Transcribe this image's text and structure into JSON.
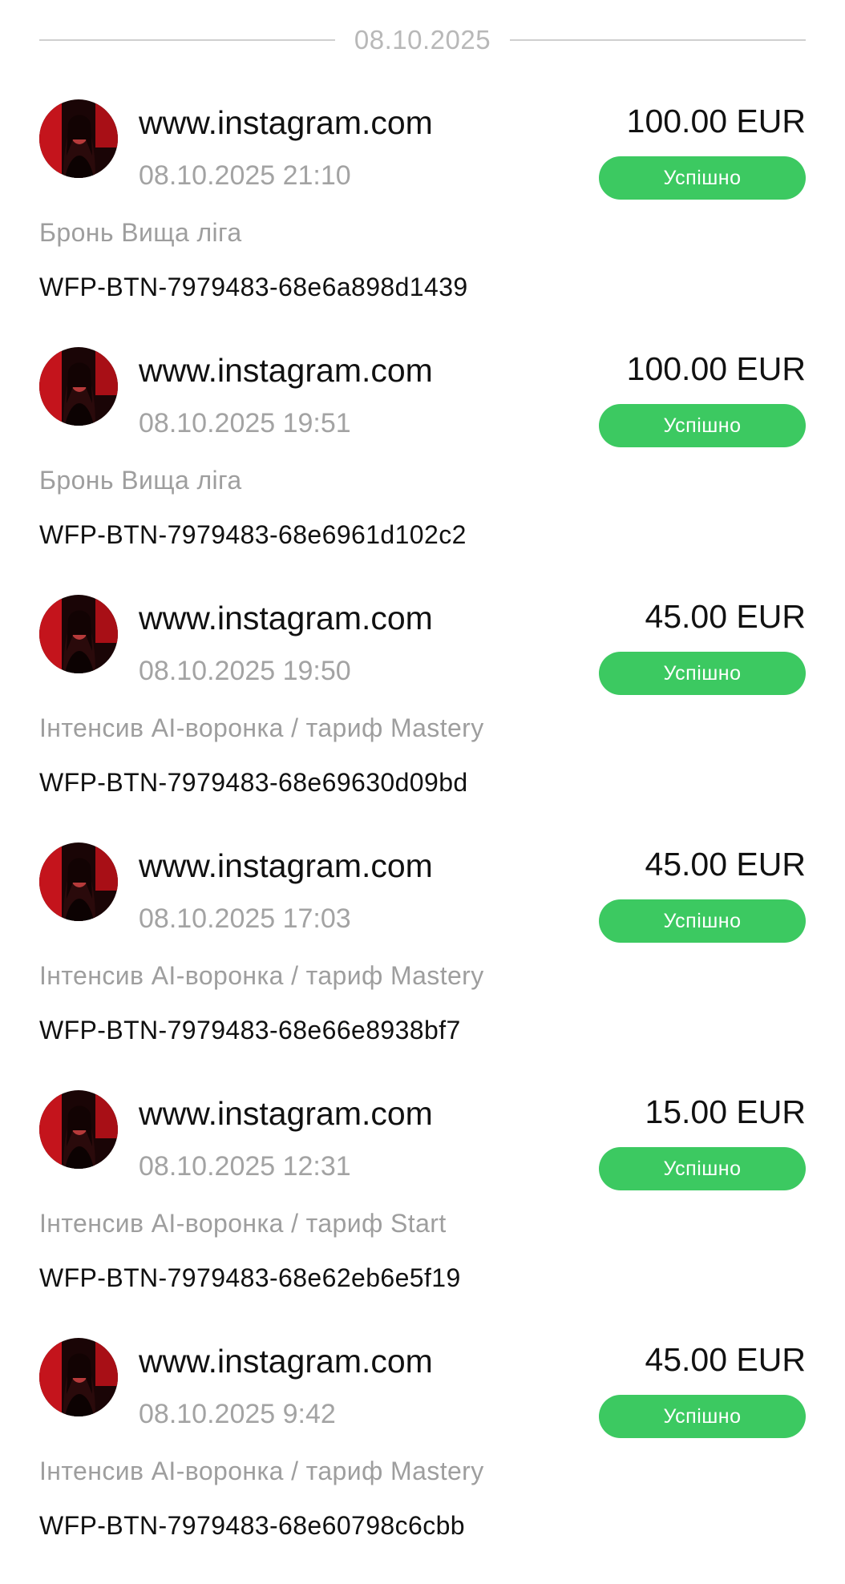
{
  "date_divider": "08.10.2025",
  "status_color": "#3cc961",
  "avatar_icon": "profile-photo",
  "transactions": [
    {
      "merchant": "www.instagram.com",
      "datetime": "08.10.2025 21:10",
      "amount": "100.00 EUR",
      "status": "Успішно",
      "description": "Бронь Вища ліга",
      "order_id": "WFP-BTN-7979483-68e6a898d1439"
    },
    {
      "merchant": "www.instagram.com",
      "datetime": "08.10.2025 19:51",
      "amount": "100.00 EUR",
      "status": "Успішно",
      "description": "Бронь Вища ліга",
      "order_id": "WFP-BTN-7979483-68e6961d102c2"
    },
    {
      "merchant": "www.instagram.com",
      "datetime": "08.10.2025 19:50",
      "amount": "45.00 EUR",
      "status": "Успішно",
      "description": "Інтенсив AI-воронка / тариф Mastery",
      "order_id": "WFP-BTN-7979483-68e69630d09bd"
    },
    {
      "merchant": "www.instagram.com",
      "datetime": "08.10.2025 17:03",
      "amount": "45.00 EUR",
      "status": "Успішно",
      "description": "Інтенсив AI-воронка / тариф Mastery",
      "order_id": "WFP-BTN-7979483-68e66e8938bf7"
    },
    {
      "merchant": "www.instagram.com",
      "datetime": "08.10.2025 12:31",
      "amount": "15.00 EUR",
      "status": "Успішно",
      "description": "Інтенсив AI-воронка / тариф Start",
      "order_id": "WFP-BTN-7979483-68e62eb6e5f19"
    },
    {
      "merchant": "www.instagram.com",
      "datetime": "08.10.2025 9:42",
      "amount": "45.00 EUR",
      "status": "Успішно",
      "description": "Інтенсив AI-воронка / тариф Mastery",
      "order_id": "WFP-BTN-7979483-68e60798c6cbb"
    }
  ]
}
